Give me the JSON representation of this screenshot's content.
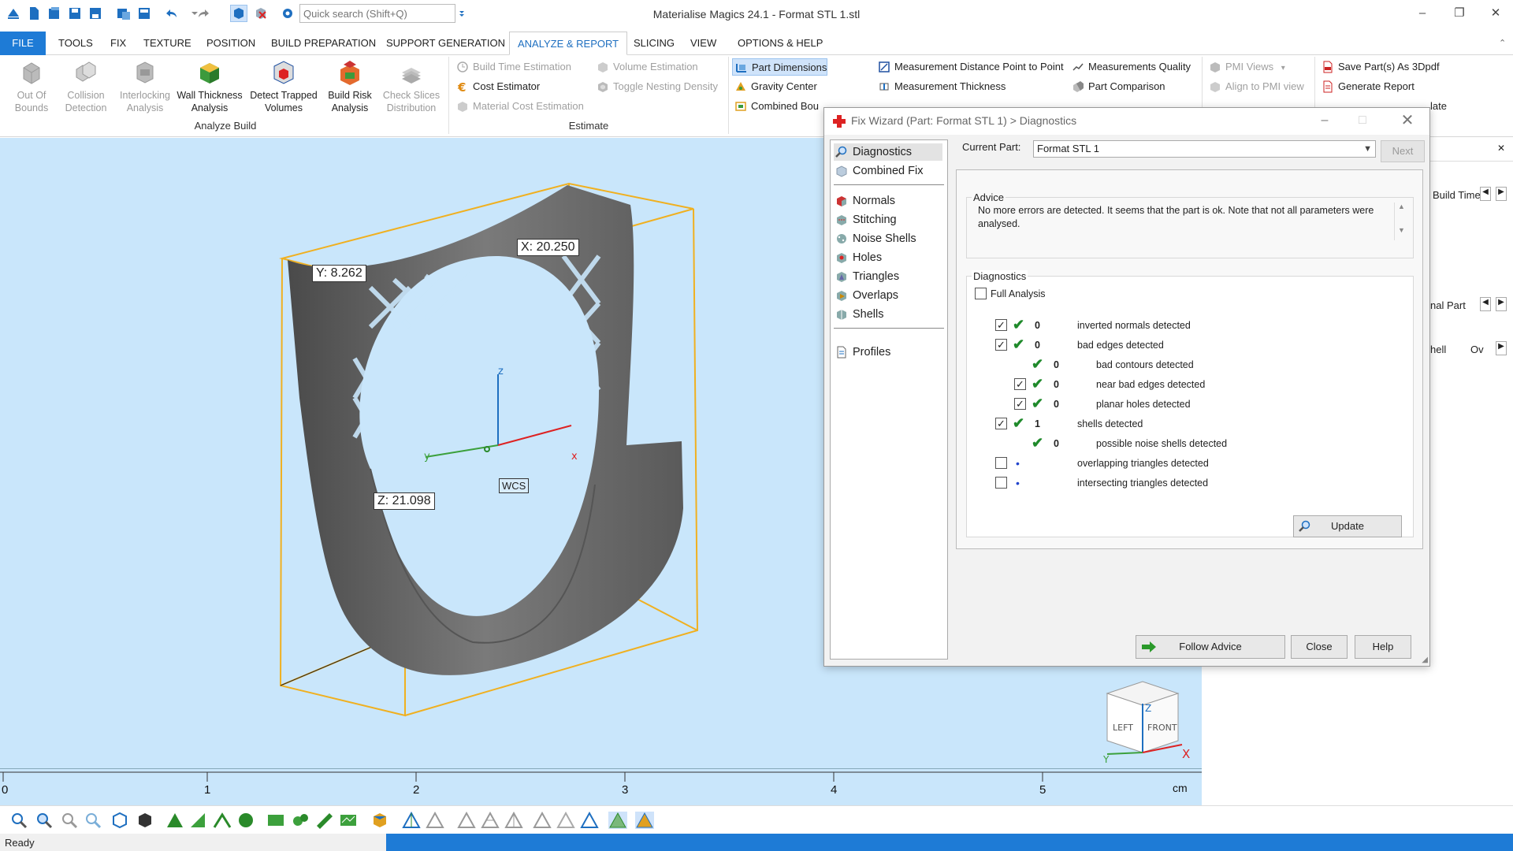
{
  "app": {
    "title": "Materialise Magics 24.1 - Format STL 1.stl",
    "quick_search_placeholder": "Quick search (Shift+Q)"
  },
  "window_controls": {
    "minimize": "–",
    "restore": "❐",
    "close": "✕"
  },
  "ribbon_tabs": [
    {
      "label": "FILE"
    },
    {
      "label": "TOOLS"
    },
    {
      "label": "FIX"
    },
    {
      "label": "TEXTURE"
    },
    {
      "label": "POSITION"
    },
    {
      "label": "BUILD PREPARATION"
    },
    {
      "label": "SUPPORT GENERATION"
    },
    {
      "label": "ANALYZE & REPORT"
    },
    {
      "label": "SLICING"
    },
    {
      "label": "VIEW"
    },
    {
      "label": "OPTIONS & HELP"
    }
  ],
  "analyze_build": {
    "group_label": "Analyze Build",
    "buttons": [
      {
        "label": "Out Of Bounds"
      },
      {
        "label": "Collision Detection"
      },
      {
        "label": "Interlocking Analysis"
      },
      {
        "label": "Wall Thickness Analysis"
      },
      {
        "label": "Detect Trapped Volumes"
      },
      {
        "label": "Build Risk Analysis"
      },
      {
        "label": "Check Slices Distribution"
      }
    ]
  },
  "estimate": {
    "group_label": "Estimate",
    "buttons": [
      {
        "label": "Build Time Estimation"
      },
      {
        "label": "Cost Estimator"
      },
      {
        "label": "Material Cost Estimation"
      },
      {
        "label": "Volume Estimation"
      },
      {
        "label": "Toggle Nesting Density"
      }
    ]
  },
  "measure": {
    "buttons": [
      {
        "label": "Part Dimensions"
      },
      {
        "label": "Gravity Center"
      },
      {
        "label": "Combined Bou"
      },
      {
        "label": "Measurement Distance Point to Point"
      },
      {
        "label": "Measurement Thickness"
      },
      {
        "label": "Measurements Quality"
      },
      {
        "label": "Part Comparison"
      },
      {
        "label": "PMI Views"
      },
      {
        "label": "Align to PMI view"
      },
      {
        "label": "Save Part(s) As 3Dpdf"
      },
      {
        "label": "Generate Report"
      }
    ],
    "truncated_right": "late"
  },
  "viewport": {
    "dim_x": "X: 20.250",
    "dim_y": "Y: 8.262",
    "dim_z": "Z: 21.098",
    "wcs": "WCS",
    "axis_x": "x",
    "axis_y": "y",
    "axis_z": "z",
    "viewcube": {
      "left": "LEFT",
      "front": "FRONT",
      "z": "Z",
      "x": "X",
      "y": "Y"
    }
  },
  "right_panel": {
    "rows": [
      {
        "label": "Build Time"
      },
      {
        "label": "nal Part"
      },
      {
        "label": "hell"
      },
      {
        "label": "Ov"
      }
    ]
  },
  "ruler": {
    "ticks": [
      "0",
      "1",
      "2",
      "3",
      "4",
      "5"
    ],
    "unit": "cm"
  },
  "status": {
    "text": "Ready"
  },
  "fix_wizard": {
    "title": "Fix Wizard (Part: Format STL 1) > Diagnostics",
    "nav": [
      {
        "label": "Diagnostics"
      },
      {
        "label": "Combined Fix"
      },
      {
        "label": "Normals"
      },
      {
        "label": "Stitching"
      },
      {
        "label": "Noise Shells"
      },
      {
        "label": "Holes"
      },
      {
        "label": "Triangles"
      },
      {
        "label": "Overlaps"
      },
      {
        "label": "Shells"
      },
      {
        "label": "Profiles"
      }
    ],
    "current_part_label": "Current Part:",
    "current_part_value": "Format STL 1",
    "next_label": "Next",
    "advice_title": "Advice",
    "advice_text": "No more errors are detected. It seems that the part is ok. Note that not all parameters were analysed.",
    "diagnostics_title": "Diagnostics",
    "full_analysis_label": "Full Analysis",
    "items": [
      {
        "count": "0",
        "text": "inverted normals detected",
        "checked": true,
        "status": "ok"
      },
      {
        "count": "0",
        "text": "bad edges detected",
        "checked": true,
        "status": "ok"
      },
      {
        "count": "0",
        "text": "bad contours detected",
        "checked": null,
        "status": "ok"
      },
      {
        "count": "0",
        "text": "near bad edges detected",
        "checked": true,
        "status": "ok"
      },
      {
        "count": "0",
        "text": "planar holes detected",
        "checked": true,
        "status": "ok"
      },
      {
        "count": "1",
        "text": "shells detected",
        "checked": true,
        "status": "ok"
      },
      {
        "count": "0",
        "text": "possible noise shells detected",
        "checked": null,
        "status": "ok"
      },
      {
        "count": "",
        "text": "overlapping triangles detected",
        "checked": false,
        "status": "pending"
      },
      {
        "count": "",
        "text": "intersecting triangles detected",
        "checked": false,
        "status": "pending"
      }
    ],
    "update_label": "Update",
    "follow_advice_label": "Follow Advice",
    "close_label": "Close",
    "help_label": "Help"
  },
  "colors": {
    "accent": "#1e7bd6",
    "viewport_bg": "#c9e6fb",
    "bounding_box": "#f0b020",
    "ok_tick": "#1f8a2b"
  }
}
